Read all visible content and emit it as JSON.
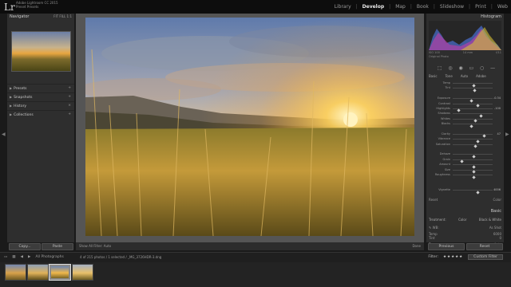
{
  "app": {
    "logo": "Lr",
    "info_line1": "Adobe Lightroom CC 2015",
    "info_line2": "Preset Presets"
  },
  "modules": [
    "Library",
    "Develop",
    "Map",
    "Book",
    "Slideshow",
    "Print",
    "Web"
  ],
  "active_module": "Develop",
  "left_panel": {
    "navigator_title": "Navigator",
    "zoom_options": "FIT  FILL  1:1",
    "sections": [
      "Presets",
      "Snapshots",
      "History",
      "Collections"
    ],
    "copy_button": "Copy...",
    "paste_button": "Paste"
  },
  "right_panel": {
    "histogram_title": "Histogram",
    "hist_info_left": "ISO 100",
    "hist_info_mid": "14 mm",
    "hist_info_right": "f/11",
    "original_photo": "Original Photo",
    "treatment_tabs": [
      "Basic",
      "Tone",
      "Auto",
      "Adobe"
    ],
    "sliders": [
      {
        "label": "Temp",
        "value": ""
      },
      {
        "label": "Tint",
        "value": ""
      },
      {
        "label": "",
        "value": ""
      },
      {
        "label": "Exposure",
        "value": "-0.34"
      },
      {
        "label": "Contrast",
        "value": ""
      },
      {
        "label": "Highlights",
        "value": "-100"
      },
      {
        "label": "Shadows",
        "value": ""
      },
      {
        "label": "Whites",
        "value": ""
      },
      {
        "label": "Blacks",
        "value": ""
      },
      {
        "label": "",
        "value": ""
      },
      {
        "label": "Clarity",
        "value": "47"
      },
      {
        "label": "Vibrance",
        "value": ""
      },
      {
        "label": "Saturation",
        "value": ""
      },
      {
        "label": "",
        "value": ""
      },
      {
        "label": "Dehaze",
        "value": ""
      },
      {
        "label": "Grain",
        "value": ""
      },
      {
        "label": "Amount",
        "value": ""
      },
      {
        "label": "Size",
        "value": ""
      },
      {
        "label": "Roughness",
        "value": ""
      },
      {
        "label": "",
        "value": ""
      },
      {
        "label": "",
        "value": ""
      },
      {
        "label": "Vignette",
        "value": "4006"
      }
    ],
    "reset_label": "Reset",
    "color_label": "Color",
    "basic_title": "Basic",
    "treatment_label": "Treatment:",
    "treatment_color": "Color",
    "treatment_bw": "Black & White",
    "wb_label": "WB:",
    "wb_value": "As Shot",
    "temp_label": "Temp",
    "temp_value": "6000",
    "tint_label": "Tint",
    "tint_value": "0",
    "tone_label": "Tone",
    "auto_label": "Auto",
    "previous_button": "Previous",
    "reset_button": "Reset"
  },
  "toolbar": {
    "info": "Show All Filter:  Auto",
    "right_label": "Done"
  },
  "filmstrip": {
    "source": "All Photographs",
    "status": "4 of 215 photos / 1 selected / _MG_3726HDR-3.dng",
    "filter_label": "Filter:",
    "custom_filter": "Custom Filter",
    "stars": "★★★★★"
  },
  "colors": {
    "panel_bg": "#2e2e2e",
    "canvas_bg": "#555555",
    "sun": "#ffd15a",
    "sky_top": "#6f86b3",
    "grass": "#c49a3a"
  }
}
